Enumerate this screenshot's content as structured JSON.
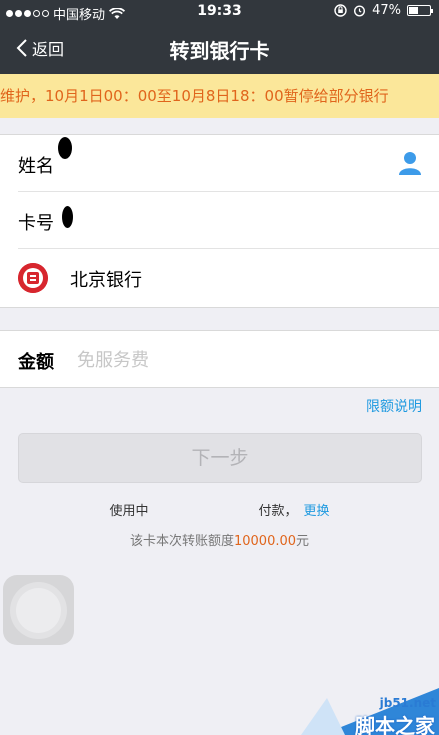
{
  "status_bar": {
    "carrier": "中国移动",
    "time": "19:33",
    "battery": "47%",
    "battery_level": 0.47
  },
  "nav": {
    "back_label": "返回",
    "title": "转到银行卡"
  },
  "notice": {
    "text": "维护，10月1日00：00至10月8日18：00暂停给部分银行"
  },
  "form": {
    "name_label": "姓名",
    "card_label": "卡号",
    "bank_name": "北京银行",
    "amount_label": "金额",
    "amount_placeholder": "免服务费",
    "amount_value": ""
  },
  "limit_link": "限额说明",
  "next_button": "下一步",
  "payment": {
    "prefix": "使用中",
    "suffix": "付款，",
    "change_label": "更换"
  },
  "limit": {
    "prefix": "该卡本次转账额度",
    "amount": "10000.00",
    "suffix": "元"
  },
  "watermark": {
    "site": "jb51.net",
    "name": "脚本之家"
  },
  "colors": {
    "header_bg": "#32373d",
    "notice_bg": "#fbe79a",
    "notice_text": "#e0651c",
    "link_blue": "#1f9ae0",
    "bank_red": "#d7262e"
  }
}
